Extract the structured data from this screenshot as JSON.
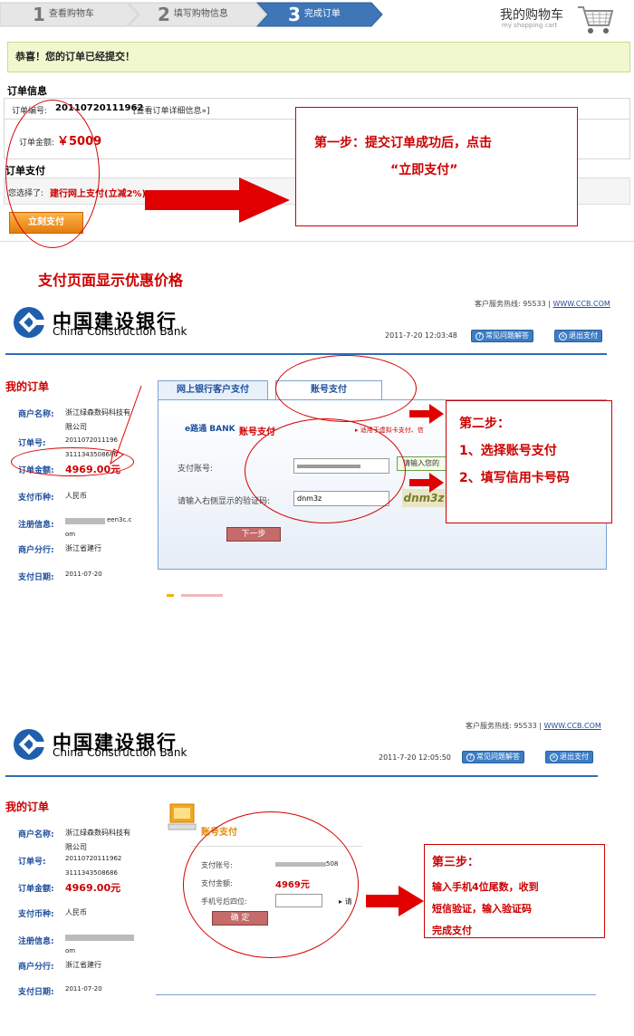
{
  "stepbar": {
    "steps": [
      {
        "num": "1",
        "label": "查看购物车"
      },
      {
        "num": "2",
        "label": "填写购物信息"
      },
      {
        "num": "3",
        "label": "完成订单"
      }
    ],
    "cart_title": "我的购物车",
    "cart_sub": "my shopping cart"
  },
  "success": {
    "text": "恭喜！您的订单已经提交！"
  },
  "order_info": {
    "title": "订单信息",
    "number_label": "订单编号:",
    "number_value": "20110720111962",
    "detail_link": "[查看订单详细信息»]",
    "amount_label": "订单金额:",
    "amount_value": "￥5009"
  },
  "payment": {
    "title": "订单支付",
    "selected_label": "您选择了:",
    "selected_value": "建行网上支付(立减2%)",
    "pay_now": "立刻支付"
  },
  "callout1": {
    "line1": "第一步：提交订单成功后，点击",
    "line2": "“立即支付”"
  },
  "promo_text": "支付页面显示优惠价格",
  "ccb1": {
    "name_cn": "中国建设银行",
    "name_en": "China Construction Bank",
    "hotline_label": "客户服务热线: 95533",
    "site": "WWW.CCB.COM",
    "time": "2011-7-20 12:03:48",
    "faq": "常见问题解答",
    "exit": "退出支付",
    "my_order": "我的订单",
    "merchant_label": "商户名称:",
    "merchant_value1": "浙江绿森数码科技有",
    "merchant_value2": "限公司",
    "order_no_label": "订单号:",
    "order_no_1": "2011072011196",
    "order_no_2": "3111343508686",
    "amount_label": "订单金额:",
    "amount_value": "4969.00元",
    "currency_label": "支付币种:",
    "currency_value": "人民币",
    "reg_label": "注册信息:",
    "reg_value": "een3c.c",
    "reg_value2": "om",
    "branch_label": "商户分行:",
    "branch_value": "浙江省建行",
    "date_label": "支付日期:",
    "date_value": "2011-07-20",
    "tab_online": "网上银行客户支付",
    "tab_account": "账号支付",
    "epay_title": "账号支付",
    "epay_logo": "e路通 BANK",
    "epay_note": "适用于虚拟卡支付、信",
    "acct_label": "支付账号:",
    "captcha_label": "请输入右侧显示的验证码:",
    "captcha_value": "dnm3z",
    "captcha_img": "dnm3z",
    "next_btn": "下一步",
    "side_btn": "请输入您的"
  },
  "callout2": {
    "title": "第二步：",
    "line1": "1、选择账号支付",
    "line2": "2、填写信用卡号码"
  },
  "ccb2": {
    "name_cn": "中国建设银行",
    "name_en": "China Construction Bank",
    "hotline_label": "客户服务热线: 95533",
    "site": "WWW.CCB.COM",
    "time": "2011-7-20 12:05:50",
    "faq": "常见问题解答",
    "exit": "退出支付",
    "my_order": "我的订单",
    "merchant_label": "商户名称:",
    "merchant_value1": "浙江绿森数码科技有",
    "merchant_value2": "限公司",
    "order_no_label": "订单号:",
    "order_no_1": "20110720111962",
    "order_no_2": "3111343508686",
    "amount_label": "订单金额:",
    "amount_value": "4969.00元",
    "currency_label": "支付币种:",
    "currency_value": "人民币",
    "reg_label": "注册信息:",
    "reg_value2": "om",
    "branch_label": "商户分行:",
    "branch_value": "浙江省建行",
    "date_label": "支付日期:",
    "date_value": "2011-07-20",
    "pay_title": "账号支付",
    "acct_label": "支付账号:",
    "acct_tail": "508",
    "amt_label": "支付金额:",
    "amt_value": "4969元",
    "phone_label": "手机号后四位:",
    "phone_hint": "请",
    "confirm_btn": "确  定"
  },
  "callout3": {
    "title": "第三步：",
    "line1": "输入手机4位尾数，收到",
    "line2": "短信验证，输入验证码",
    "line3": "完成支付"
  },
  "colors": {
    "accent_red": "#c00000",
    "ccb_blue": "#2e6cb5",
    "success_bg": "#f1f8cf"
  }
}
